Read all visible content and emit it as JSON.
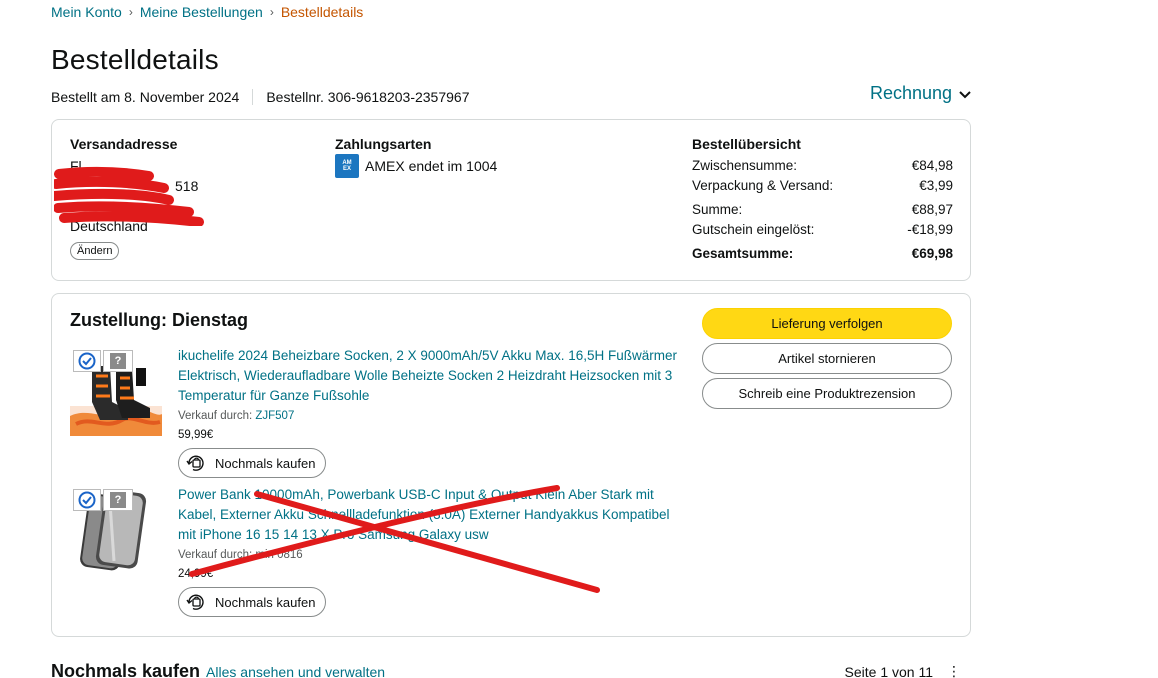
{
  "breadcrumb": {
    "items": [
      "Mein Konto",
      "Meine Bestellungen"
    ],
    "current": "Bestelldetails",
    "separator": "›"
  },
  "page": {
    "title": "Bestelldetails",
    "ordered_on": "Bestellt am 8. November 2024",
    "order_number": "Bestellnr. 306-9618203-2357967",
    "invoice_label": "Rechnung"
  },
  "address": {
    "heading": "Versandadresse",
    "lines": [
      "Fl",
      "518",
      "",
      "Deutschland"
    ],
    "change_label": "Ändern"
  },
  "payment": {
    "heading": "Zahlungsarten",
    "card_text": "AMEX endet im 1004",
    "card_icon": "amex-card-icon"
  },
  "summary": {
    "heading": "Bestellübersicht",
    "rows": [
      {
        "label": "Zwischensumme:",
        "value": "€84,98"
      },
      {
        "label": "Verpackung & Versand:",
        "value": "€3,99"
      },
      {
        "label": "Summe:",
        "value": "€88,97"
      },
      {
        "label": "Gutschein eingelöst:",
        "value": "-€18,99"
      },
      {
        "label": "Gesamtsumme:",
        "value": "€69,98"
      }
    ]
  },
  "delivery": {
    "title": "Zustellung: Dienstag",
    "buttons": {
      "track": "Lieferung verfolgen",
      "cancel": "Artikel stornieren",
      "review": "Schreib eine Produktrezension"
    },
    "items": [
      {
        "title": "ikuchelife 2024 Beheizbare Socken, 2 X 9000mAh/5V Akku Max. 16,5H Fußwärmer Elektrisch, Wiederaufladbare Wolle Beheizte Socken 2 Heizdraht Heizsocken mit 3 Temperatur für Ganze Fußsohle",
        "seller_prefix": "Verkauf durch: ",
        "seller": "ZJF507",
        "price": "59,99€",
        "buy_again": "Nochmals kaufen"
      },
      {
        "title": "Power Bank 10000mAh, Powerbank USB-C Input & Output Klein Aber Stark mit Kabel, Externer Akku Schnellladefunktion (3.0A) Externer Handyakkus Kompatibel mit iPhone 16 15 14 13 X Pro Samsung Galaxy usw",
        "seller_prefix": "Verkauf durch: ",
        "seller": "min 0816",
        "price": "24,99€",
        "buy_again": "Nochmals kaufen"
      }
    ]
  },
  "buy_again_section": {
    "title": "Nochmals kaufen",
    "link": "Alles ansehen und verwalten",
    "pager": "Seite 1 von 11"
  },
  "colors": {
    "link": "#007185",
    "breadcrumb_current": "#c45500",
    "primary_button": "#ffd814",
    "scribble_red": "#e01b1b"
  }
}
